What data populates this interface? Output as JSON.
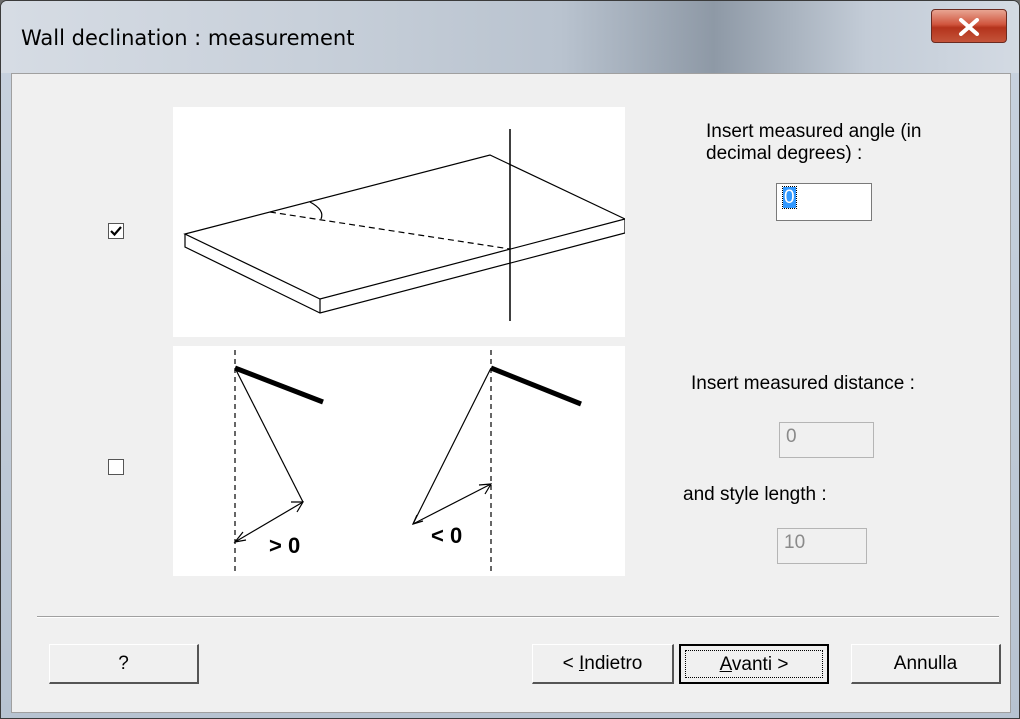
{
  "window": {
    "title": "Wall declination : measurement"
  },
  "option_angle": {
    "checked": true,
    "prompt": "Insert measured angle (in decimal degrees) :",
    "prompt_line1": "Insert measured angle (in",
    "prompt_line2": "decimal degrees) :",
    "value": "0"
  },
  "option_distance": {
    "checked": false,
    "prompt_distance": "Insert measured distance :",
    "distance_value": "0",
    "prompt_style": "and style length :",
    "style_value": "10"
  },
  "diagram": {
    "label_positive": "> 0",
    "label_negative": "< 0"
  },
  "buttons": {
    "help": "?",
    "back_prefix": "< ",
    "back_mnemonic": "I",
    "back_rest": "ndietro",
    "next_mnemonic": "A",
    "next_rest": "vanti >",
    "cancel": "Annulla"
  },
  "colors": {
    "title_close": "#c4432c",
    "selection": "#3399ff"
  },
  "icons": {
    "close": "close-icon",
    "check": "checkmark-icon"
  }
}
